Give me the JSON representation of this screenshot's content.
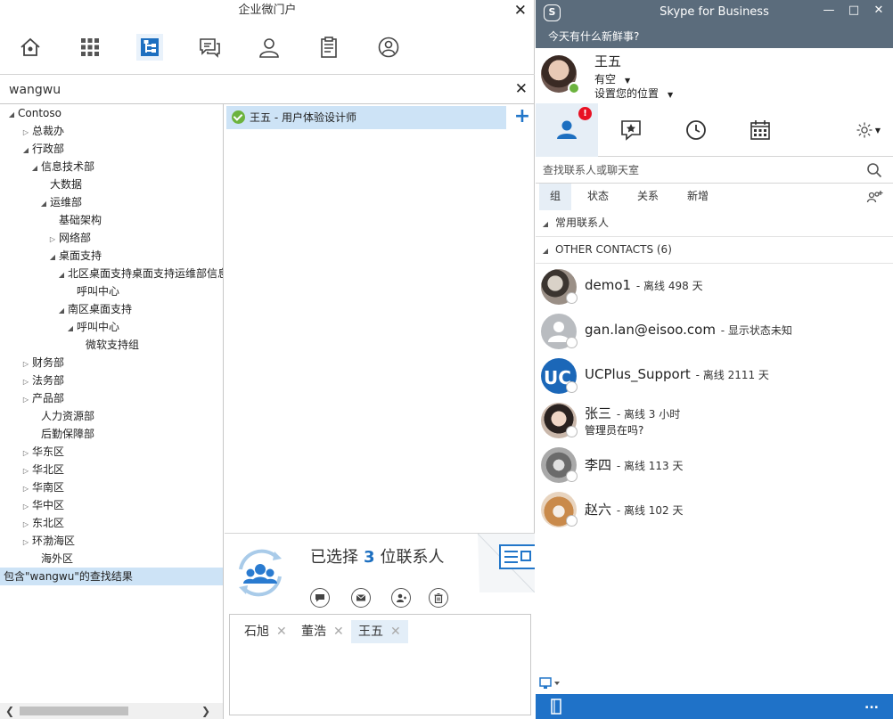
{
  "left_app": {
    "title": "企业微门户",
    "close_glyph": "✕",
    "toolbar_icons": [
      "home-icon",
      "apps-grid-icon",
      "org-tree-icon",
      "chat-icon",
      "contacts-icon",
      "clipboard-icon",
      "profile-icon"
    ],
    "search": {
      "value": "wangwu",
      "clear_glyph": "✕"
    },
    "tree": [
      {
        "label": "Contoso",
        "level": 0,
        "state": "expanded"
      },
      {
        "label": "总裁办",
        "level": 1,
        "state": "collapsed"
      },
      {
        "label": "行政部",
        "level": 1,
        "state": "expanded"
      },
      {
        "label": "信息技术部",
        "level": 2,
        "state": "expanded"
      },
      {
        "label": "大数据",
        "level": 3,
        "state": "leaf"
      },
      {
        "label": "运维部",
        "level": 3,
        "state": "expanded"
      },
      {
        "label": "基础架构",
        "level": 4,
        "state": "leaf"
      },
      {
        "label": "网络部",
        "level": 4,
        "state": "collapsed"
      },
      {
        "label": "桌面支持",
        "level": 4,
        "state": "expanded"
      },
      {
        "label": "北区桌面支持桌面支持运维部信息",
        "level": 5,
        "state": "expanded"
      },
      {
        "label": "呼叫中心",
        "level": 6,
        "state": "leaf"
      },
      {
        "label": "南区桌面支持",
        "level": 5,
        "state": "expanded"
      },
      {
        "label": "呼叫中心",
        "level": 6,
        "state": "expanded"
      },
      {
        "label": "微软支持组",
        "level": 7,
        "state": "leaf"
      },
      {
        "label": "财务部",
        "level": 1,
        "state": "collapsed"
      },
      {
        "label": "法务部",
        "level": 1,
        "state": "collapsed"
      },
      {
        "label": "产品部",
        "level": 1,
        "state": "collapsed"
      },
      {
        "label": "人力资源部",
        "level": 2,
        "state": "leaf"
      },
      {
        "label": "后勤保障部",
        "level": 2,
        "state": "leaf"
      },
      {
        "label": "华东区",
        "level": 1,
        "state": "collapsed"
      },
      {
        "label": "华北区",
        "level": 1,
        "state": "collapsed"
      },
      {
        "label": "华南区",
        "level": 1,
        "state": "collapsed"
      },
      {
        "label": "华中区",
        "level": 1,
        "state": "collapsed"
      },
      {
        "label": "东北区",
        "level": 1,
        "state": "collapsed"
      },
      {
        "label": "环渤海区",
        "level": 1,
        "state": "collapsed"
      },
      {
        "label": "海外区",
        "level": 2,
        "state": "leaf"
      },
      {
        "label": "包含\"wangwu\"的查找结果",
        "level": 1,
        "state": "selected"
      }
    ],
    "result": {
      "text": "王五 - 用户体验设计师",
      "add_glyph": "+"
    },
    "selection": {
      "prefix": "已选择",
      "count": "3",
      "suffix": "位联系人"
    },
    "actions": [
      "chat-icon",
      "mail-icon",
      "add-person-icon",
      "delete-icon"
    ],
    "chips": [
      {
        "label": "石旭",
        "active": false
      },
      {
        "label": "董浩",
        "active": false
      },
      {
        "label": "王五",
        "active": true
      }
    ],
    "chip_remove_glyph": "✕",
    "scroll_left": "❮",
    "scroll_right": "❯"
  },
  "skype": {
    "title": "Skype for Business",
    "logo_letter": "S",
    "news": "今天有什么新鲜事?",
    "me": {
      "name": "王五",
      "status": "有空",
      "location": "设置您的位置"
    },
    "tabs_badge": "!",
    "search_placeholder": "查找联系人或聊天室",
    "filters": [
      "组",
      "状态",
      "关系",
      "新增"
    ],
    "groups": [
      {
        "label": "常用联系人"
      },
      {
        "label": "OTHER CONTACTS (6)"
      }
    ],
    "contacts": [
      {
        "name": "demo1",
        "status": " - 离线 498 天",
        "note": ""
      },
      {
        "name": "gan.lan@eisoo.com",
        "status": " - 显示状态未知",
        "note": ""
      },
      {
        "name": "UCPlus_Support",
        "status": " - 离线 2111 天",
        "note": ""
      },
      {
        "name": "张三",
        "status": " - 离线 3 小时",
        "note": "管理员在吗?"
      },
      {
        "name": "李四",
        "status": " - 离线 113 天",
        "note": ""
      },
      {
        "name": "赵六",
        "status": " - 离线 102 天",
        "note": ""
      }
    ],
    "more_glyph": "..."
  },
  "colors": {
    "skype_header": "#5b6c7c",
    "skype_footer": "#1f72c8",
    "accent_blue": "#1d6fc0",
    "presence_available": "#6cb33e",
    "selection_bg": "#cde3f6"
  }
}
